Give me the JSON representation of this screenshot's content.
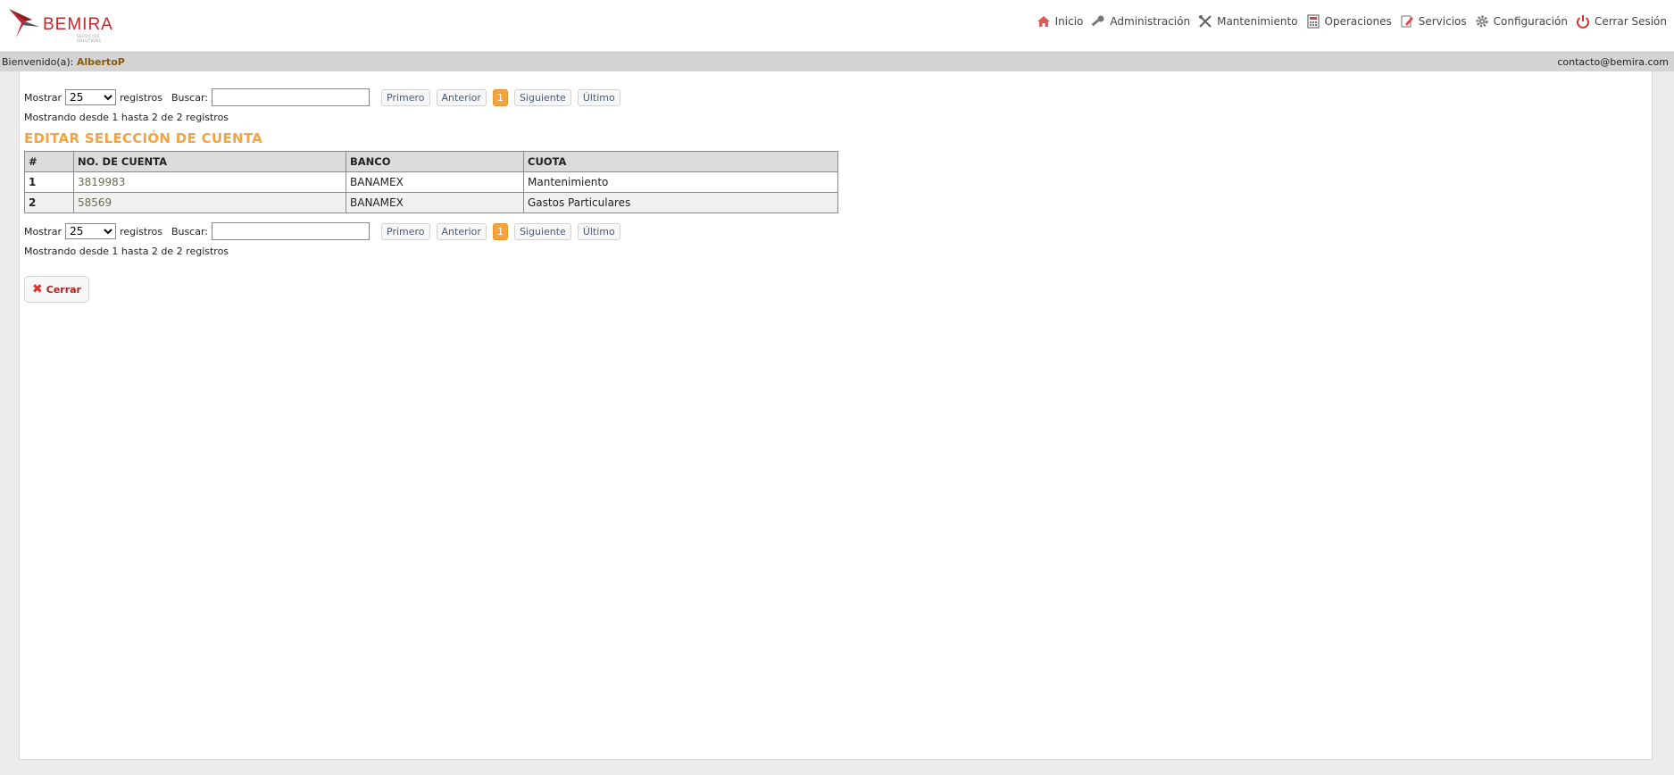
{
  "brand": {
    "name": "BEMIRA",
    "tagline": "SERVICIOS SOLUTIONS",
    "logo_color": "#c0272d"
  },
  "nav": {
    "items": [
      {
        "label": "Inicio",
        "icon": "home-icon"
      },
      {
        "label": "Administración",
        "icon": "key-icon"
      },
      {
        "label": "Mantenimiento",
        "icon": "tools-icon"
      },
      {
        "label": "Operaciones",
        "icon": "calculator-icon"
      },
      {
        "label": "Servicios",
        "icon": "edit-icon"
      },
      {
        "label": "Configuración",
        "icon": "gear-icon"
      },
      {
        "label": "Cerrar Sesión",
        "icon": "power-icon"
      }
    ]
  },
  "welcome": {
    "prefix": "Bienvenido(a):",
    "user": "AlbertoP"
  },
  "contact": "contacto@bemira.com",
  "controls": {
    "show_label": "Mostrar",
    "page_size": "25",
    "records_label": "registros",
    "search_label": "Buscar:",
    "search_value": "",
    "pager": {
      "first": "Primero",
      "prev": "Anterior",
      "page": "1",
      "next": "Siguiente",
      "last": "Último"
    }
  },
  "info": "Mostrando desde 1 hasta 2 de 2 registros",
  "title": "EDITAR SELECCIÓN DE CUENTA",
  "table": {
    "headers": [
      "#",
      "NO. DE CUENTA",
      "BANCO",
      "CUOTA"
    ],
    "rows": [
      [
        "1",
        "3819983",
        "BANAMEX",
        "Mantenimiento"
      ],
      [
        "2",
        "58569",
        "BANAMEX",
        "Gastos Particulares"
      ]
    ]
  },
  "close_button": "Cerrar",
  "colors": {
    "accent": "#f4a340",
    "danger": "#d9302c",
    "user": "#8a5a0c"
  }
}
